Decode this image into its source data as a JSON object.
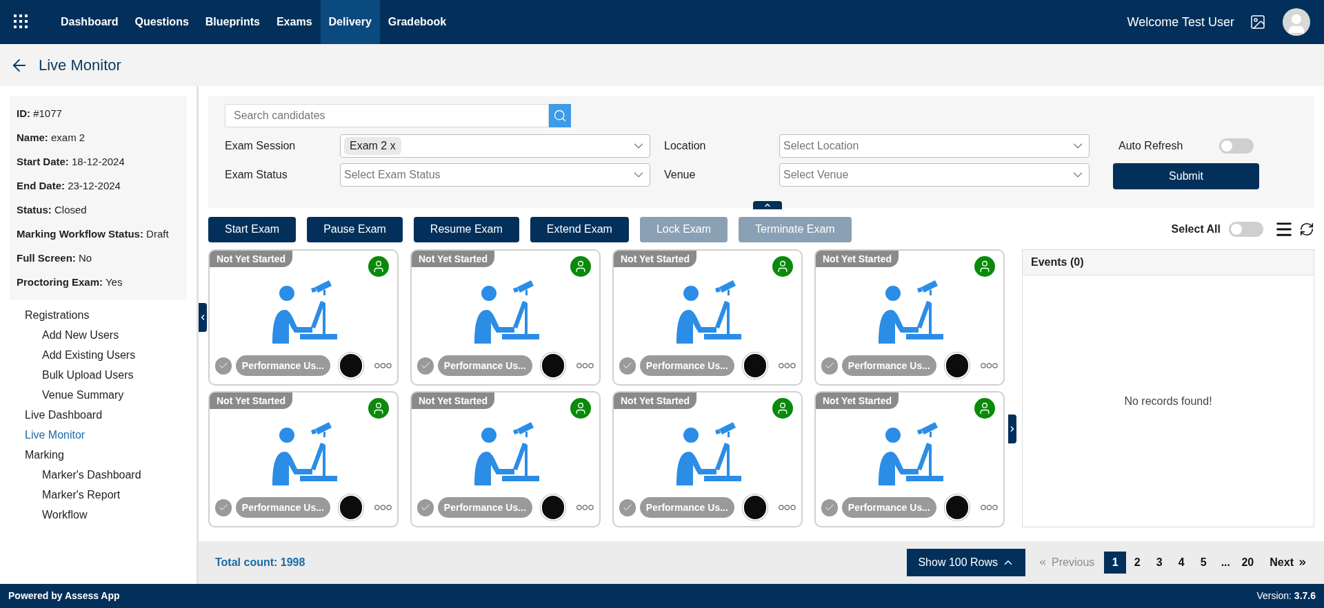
{
  "nav": {
    "items": [
      {
        "label": "Dashboard",
        "selected": false
      },
      {
        "label": "Questions",
        "selected": false
      },
      {
        "label": "Blueprints",
        "selected": false
      },
      {
        "label": "Exams",
        "selected": false
      },
      {
        "label": "Delivery",
        "selected": true
      },
      {
        "label": "Gradebook",
        "selected": false
      }
    ],
    "welcome": "Welcome Test User"
  },
  "page_title": "Live Monitor",
  "exam_info": [
    "**ID:** #1077",
    "**Name:** exam 2",
    "**Start Date:** 18-12-2024",
    "**End Date:** 23-12-2024",
    "**Status:** Closed",
    "**Marking Workflow Status:** Draft",
    "**Full Screen:** No",
    "**Proctoring Exam:** Yes"
  ],
  "sidebar": {
    "items": [
      {
        "label": "Registrations",
        "selected": false,
        "children": [
          {
            "label": "Add New Users",
            "selected": false
          },
          {
            "label": "Add Existing Users",
            "selected": false
          },
          {
            "label": "Bulk Upload Users",
            "selected": false
          },
          {
            "label": "Venue Summary",
            "selected": false
          }
        ]
      },
      {
        "label": "Live Dashboard",
        "selected": false
      },
      {
        "label": "Live Monitor",
        "selected": true
      },
      {
        "label": "Marking",
        "selected": false,
        "children": [
          {
            "label": "Marker's Dashboard",
            "selected": false
          },
          {
            "label": "Marker's Report",
            "selected": false
          },
          {
            "label": "Workflow",
            "selected": false
          }
        ]
      }
    ]
  },
  "filters": {
    "search": {
      "placeholder": "Search candidates"
    },
    "exam_session": {
      "label": "Exam Session",
      "chip": "Exam 2 x"
    },
    "location": {
      "label": "Location",
      "placeholder": "Select Location"
    },
    "exam_status": {
      "label": "Exam Status",
      "placeholder": "Select Exam Status"
    },
    "venue": {
      "label": "Venue",
      "placeholder": "Select Venue"
    },
    "auto_refresh": {
      "label": "Auto Refresh",
      "on": false
    },
    "submit": "Submit"
  },
  "actions": [
    {
      "label": "Start Exam",
      "disabled": false
    },
    {
      "label": "Pause Exam",
      "disabled": false
    },
    {
      "label": "Resume Exam",
      "disabled": false
    },
    {
      "label": "Extend Exam",
      "disabled": false
    },
    {
      "label": "Lock Exam",
      "disabled": true
    },
    {
      "label": "Terminate Exam",
      "disabled": true
    }
  ],
  "select_all": {
    "label": "Select All",
    "on": false
  },
  "cards": [
    {
      "status": "Not Yet Started",
      "name": "Performance Us...",
      "online": true
    },
    {
      "status": "Not Yet Started",
      "name": "Performance Us...",
      "online": true
    },
    {
      "status": "Not Yet Started",
      "name": "Performance Us...",
      "online": true
    },
    {
      "status": "Not Yet Started",
      "name": "Performance Us...",
      "online": true
    },
    {
      "status": "Not Yet Started",
      "name": "Performance Us...",
      "online": true
    },
    {
      "status": "Not Yet Started",
      "name": "Performance Us...",
      "online": true
    },
    {
      "status": "Not Yet Started",
      "name": "Performance Us...",
      "online": true
    },
    {
      "status": "Not Yet Started",
      "name": "Performance Us...",
      "online": true
    }
  ],
  "events": {
    "title": "Events (0)",
    "empty": "No records found!"
  },
  "footer": {
    "total": "Total count: 1998",
    "rows_button": "Show 100 Rows",
    "previous": {
      "label": "Previous",
      "disabled": true
    },
    "pages": [
      {
        "label": "1",
        "selected": true
      },
      {
        "label": "2",
        "selected": false
      },
      {
        "label": "3",
        "selected": false
      },
      {
        "label": "4",
        "selected": false
      },
      {
        "label": "5",
        "selected": false
      },
      {
        "label": "...",
        "selected": false
      },
      {
        "label": "20",
        "selected": false
      }
    ],
    "next": {
      "label": "Next",
      "disabled": false
    }
  },
  "bottom_bar": {
    "powered": "Powered by Assess App",
    "version": "Version: **3.7.6**"
  }
}
